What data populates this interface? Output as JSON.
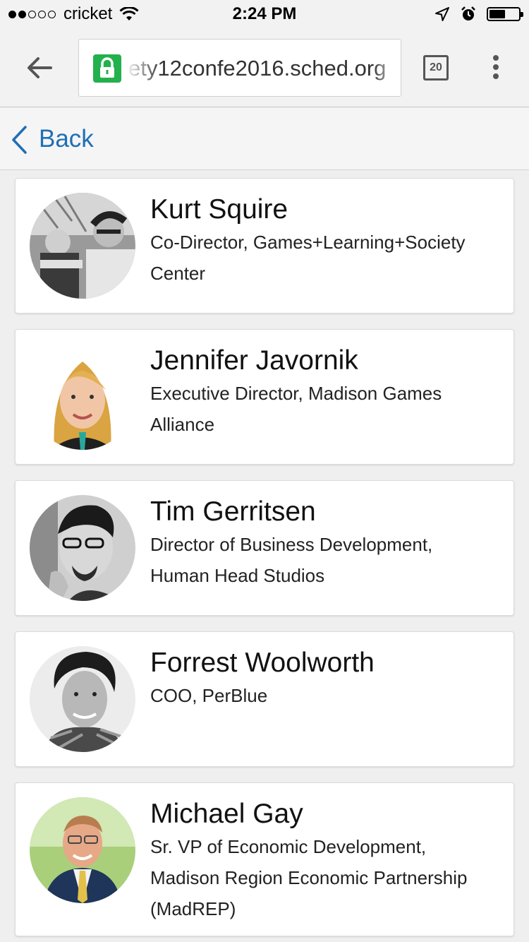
{
  "status_bar": {
    "carrier": "cricket",
    "time": "2:24 PM",
    "signal_bars_filled": 2,
    "signal_bars_total": 5,
    "battery_level": 0.55
  },
  "browser": {
    "url": "ety12confe2016.sched.org",
    "tab_count": "20",
    "icons": {
      "back": "arrow-left-icon",
      "lock": "lock-icon",
      "tabs": "tabs-icon",
      "menu": "more-vertical-icon"
    },
    "lock_color": "#22b14c"
  },
  "nav": {
    "back_label": "Back",
    "link_color": "#1f6fb5"
  },
  "speakers": [
    {
      "name": "Kurt Squire",
      "role_lines": [
        "Co-Director, Games+Learning+Society",
        "Center"
      ]
    },
    {
      "name": "Jennifer Javornik",
      "role_lines": [
        "Executive Director, Madison Games",
        "Alliance"
      ]
    },
    {
      "name": "Tim Gerritsen",
      "role_lines": [
        "Director of Business Development,",
        "Human Head Studios"
      ]
    },
    {
      "name": "Forrest Woolworth",
      "role_lines": [
        "COO, PerBlue"
      ]
    },
    {
      "name": "Michael Gay",
      "role_lines": [
        "Sr. VP of Economic Development,",
        "Madison Region Economic Partnership",
        "(MadREP)"
      ]
    }
  ]
}
